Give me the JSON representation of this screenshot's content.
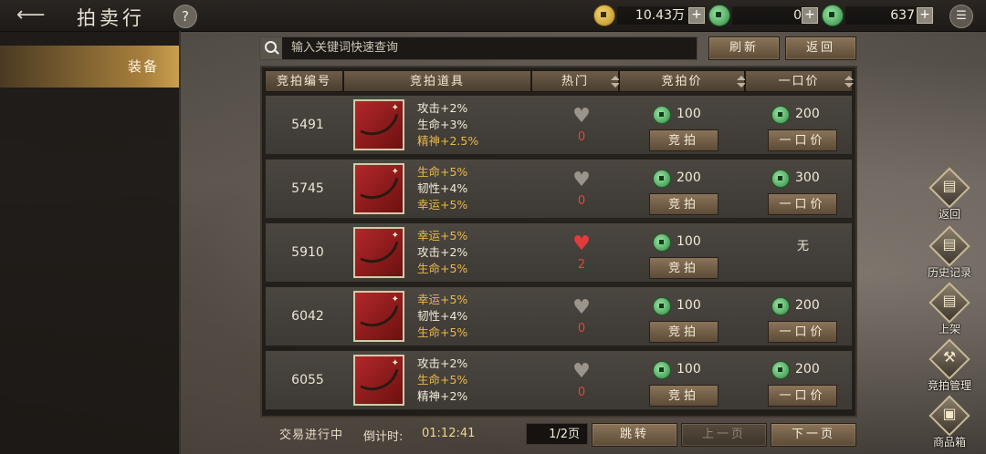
{
  "header": {
    "title": "拍卖行",
    "help": "?",
    "currencies": [
      {
        "icon": "gold-coin-icon",
        "value": "10.43万",
        "plus": "+"
      },
      {
        "icon": "jade-coin-icon",
        "value": "0",
        "plus": "+"
      },
      {
        "icon": "jade-ingot-icon",
        "value": "637",
        "plus": "+"
      }
    ],
    "menu_icon": "☰"
  },
  "sidebar": {
    "items": [
      {
        "label": "装备",
        "active": true
      }
    ]
  },
  "search": {
    "placeholder": "输入关键词快速查询",
    "refresh_label": "刷新",
    "return_label": "返回"
  },
  "table": {
    "headers": [
      "竞拍编号",
      "竞拍道具",
      "热门",
      "竞拍价",
      "一口价"
    ],
    "bid_button": "竞拍",
    "buyout_button": "一口价",
    "rows": [
      {
        "id": "5491",
        "stats": [
          {
            "text": "攻击+2%",
            "color": "#f2ead8"
          },
          {
            "text": "生命+3%",
            "color": "#f2ead8"
          },
          {
            "text": "精神+2.5%",
            "color": "#e8b84a"
          }
        ],
        "hot": "0",
        "liked": false,
        "bid": "100",
        "buyout": "200"
      },
      {
        "id": "5745",
        "stats": [
          {
            "text": "生命+5%",
            "color": "#e8b84a"
          },
          {
            "text": "韧性+4%",
            "color": "#f2ead8"
          },
          {
            "text": "幸运+5%",
            "color": "#e8b84a"
          }
        ],
        "hot": "0",
        "liked": false,
        "bid": "200",
        "buyout": "300"
      },
      {
        "id": "5910",
        "stats": [
          {
            "text": "幸运+5%",
            "color": "#e8b84a"
          },
          {
            "text": "攻击+2%",
            "color": "#f2ead8"
          },
          {
            "text": "生命+5%",
            "color": "#e8b84a"
          }
        ],
        "hot": "2",
        "liked": true,
        "bid": "100",
        "buyout": "无"
      },
      {
        "id": "6042",
        "stats": [
          {
            "text": "幸运+5%",
            "color": "#e8b84a"
          },
          {
            "text": "韧性+4%",
            "color": "#f2ead8"
          },
          {
            "text": "生命+5%",
            "color": "#e8b84a"
          }
        ],
        "hot": "0",
        "liked": false,
        "bid": "100",
        "buyout": "200"
      },
      {
        "id": "6055",
        "stats": [
          {
            "text": "攻击+2%",
            "color": "#f2ead8"
          },
          {
            "text": "生命+5%",
            "color": "#e8b84a"
          },
          {
            "text": "精神+2%",
            "color": "#f2ead8"
          }
        ],
        "hot": "0",
        "liked": false,
        "bid": "100",
        "buyout": "200"
      }
    ]
  },
  "footer": {
    "status": "交易进行中",
    "countdown_label": "倒计时:",
    "countdown": "01:12:41",
    "page": "1/2页",
    "jump_label": "跳转",
    "prev_label": "上一页",
    "next_label": "下一页"
  },
  "side_buttons": [
    {
      "label": "返回",
      "icon": "return-icon"
    },
    {
      "label": "历史记录",
      "icon": "history-icon"
    },
    {
      "label": "上架",
      "icon": "list-item-icon"
    },
    {
      "label": "竞拍管理",
      "icon": "auction-manage-icon"
    },
    {
      "label": "商品箱",
      "icon": "goods-box-icon"
    }
  ]
}
